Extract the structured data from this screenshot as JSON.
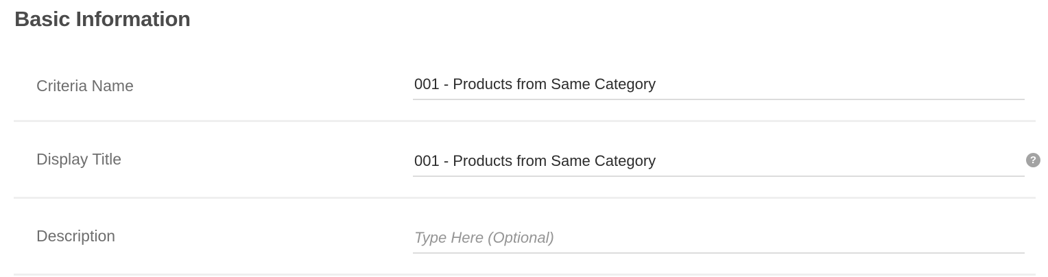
{
  "section": {
    "title": "Basic Information"
  },
  "fields": {
    "criteria_name": {
      "label": "Criteria Name",
      "value": "001 - Products from Same Category"
    },
    "display_title": {
      "label": "Display Title",
      "value": "001 - Products from Same Category",
      "help_icon": "?"
    },
    "description": {
      "label": "Description",
      "value": "",
      "placeholder": "Type Here (Optional)"
    }
  }
}
